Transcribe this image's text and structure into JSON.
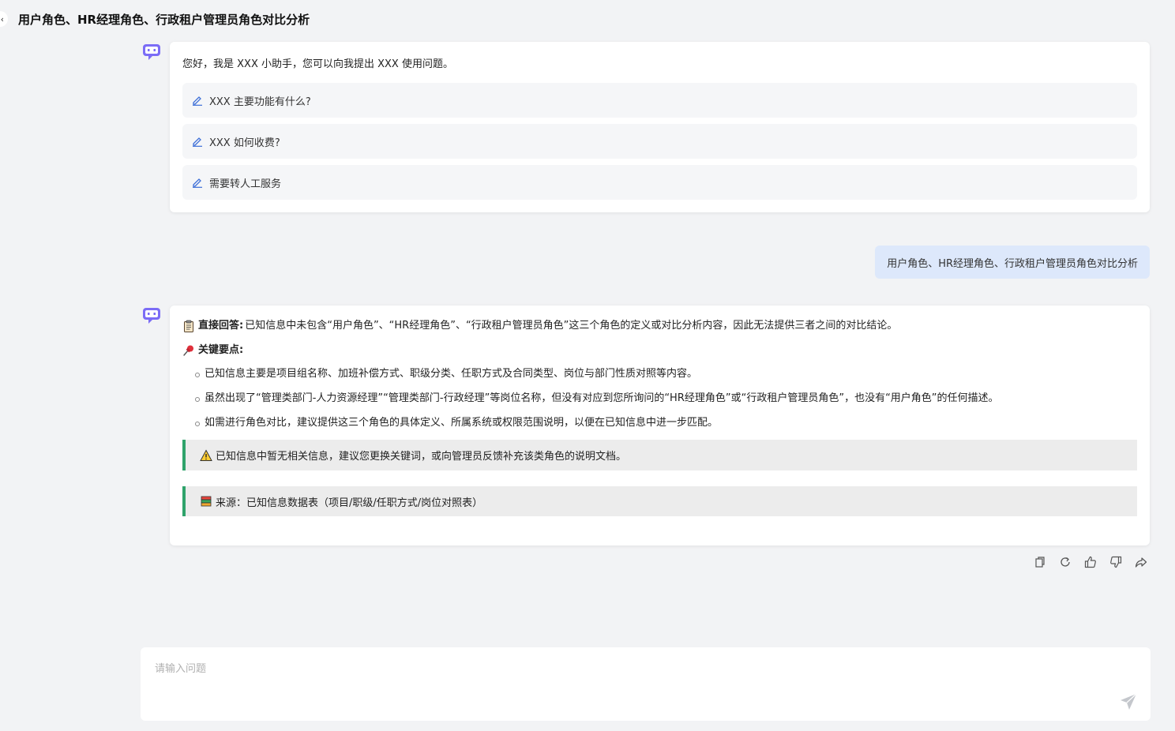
{
  "header": {
    "back_icon": "‹",
    "title": "用户角色、HR经理角色、行政租户管理员角色对比分析"
  },
  "greeting": {
    "text": "您好，我是 XXX 小助手，您可以向我提出 XXX 使用问题。",
    "suggestions": [
      "XXX 主要功能有什么?",
      "XXX 如何收费?",
      "需要转人工服务"
    ]
  },
  "user_message": "用户角色、HR经理角色、行政租户管理员角色对比分析",
  "answer": {
    "direct_label": "直接回答:",
    "direct_text": "已知信息中未包含“用户角色”、“HR经理角色”、“行政租户管理员角色”这三个角色的定义或对比分析内容，因此无法提供三者之间的对比结论。",
    "key_points_label": "关键要点:",
    "bullets": [
      "已知信息主要是项目组名称、加班补偿方式、职级分类、任职方式及合同类型、岗位与部门性质对照等内容。",
      "虽然出现了“管理类部门-人力资源经理”“管理类部门-行政经理”等岗位名称，但没有对应到您所询问的“HR经理角色”或“行政租户管理员角色”，也没有“用户角色”的任何描述。",
      "如需进行角色对比，建议提供这三个角色的具体定义、所属系统或权限范围说明，以便在已知信息中进一步匹配。"
    ],
    "warning": "已知信息中暂无相关信息，建议您更换关键词，或向管理员反馈补充该类角色的说明文档。",
    "source": "来源：已知信息数据表（项目/职级/任职方式/岗位对照表）"
  },
  "input": {
    "placeholder": "请输入问题"
  },
  "icons": {
    "bot": "robot-avatar-icon",
    "suggestion": "pencil-icon",
    "actions": [
      "copy-icon",
      "refresh-icon",
      "thumbs-up-icon",
      "thumbs-down-icon",
      "share-icon"
    ],
    "send": "paper-plane-icon"
  },
  "colors": {
    "accent": "#6b5cf6",
    "quote_bar": "#2fa36b",
    "user_bubble": "#dde8fb"
  }
}
